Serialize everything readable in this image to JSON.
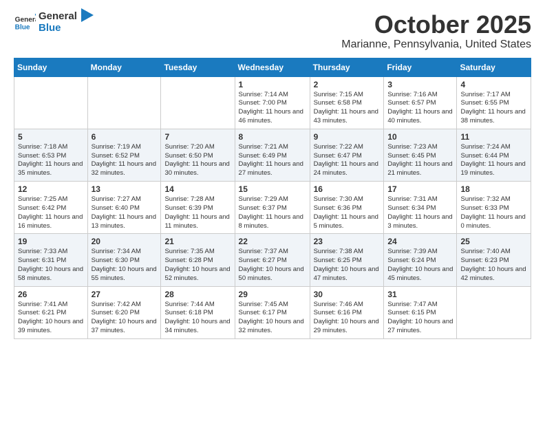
{
  "logo": {
    "line1": "General",
    "line2": "Blue"
  },
  "title": "October 2025",
  "subtitle": "Marianne, Pennsylvania, United States",
  "days_of_week": [
    "Sunday",
    "Monday",
    "Tuesday",
    "Wednesday",
    "Thursday",
    "Friday",
    "Saturday"
  ],
  "weeks": [
    [
      {
        "day": "",
        "info": ""
      },
      {
        "day": "",
        "info": ""
      },
      {
        "day": "",
        "info": ""
      },
      {
        "day": "1",
        "info": "Sunrise: 7:14 AM\nSunset: 7:00 PM\nDaylight: 11 hours and 46 minutes."
      },
      {
        "day": "2",
        "info": "Sunrise: 7:15 AM\nSunset: 6:58 PM\nDaylight: 11 hours and 43 minutes."
      },
      {
        "day": "3",
        "info": "Sunrise: 7:16 AM\nSunset: 6:57 PM\nDaylight: 11 hours and 40 minutes."
      },
      {
        "day": "4",
        "info": "Sunrise: 7:17 AM\nSunset: 6:55 PM\nDaylight: 11 hours and 38 minutes."
      }
    ],
    [
      {
        "day": "5",
        "info": "Sunrise: 7:18 AM\nSunset: 6:53 PM\nDaylight: 11 hours and 35 minutes."
      },
      {
        "day": "6",
        "info": "Sunrise: 7:19 AM\nSunset: 6:52 PM\nDaylight: 11 hours and 32 minutes."
      },
      {
        "day": "7",
        "info": "Sunrise: 7:20 AM\nSunset: 6:50 PM\nDaylight: 11 hours and 30 minutes."
      },
      {
        "day": "8",
        "info": "Sunrise: 7:21 AM\nSunset: 6:49 PM\nDaylight: 11 hours and 27 minutes."
      },
      {
        "day": "9",
        "info": "Sunrise: 7:22 AM\nSunset: 6:47 PM\nDaylight: 11 hours and 24 minutes."
      },
      {
        "day": "10",
        "info": "Sunrise: 7:23 AM\nSunset: 6:45 PM\nDaylight: 11 hours and 21 minutes."
      },
      {
        "day": "11",
        "info": "Sunrise: 7:24 AM\nSunset: 6:44 PM\nDaylight: 11 hours and 19 minutes."
      }
    ],
    [
      {
        "day": "12",
        "info": "Sunrise: 7:25 AM\nSunset: 6:42 PM\nDaylight: 11 hours and 16 minutes."
      },
      {
        "day": "13",
        "info": "Sunrise: 7:27 AM\nSunset: 6:40 PM\nDaylight: 11 hours and 13 minutes."
      },
      {
        "day": "14",
        "info": "Sunrise: 7:28 AM\nSunset: 6:39 PM\nDaylight: 11 hours and 11 minutes."
      },
      {
        "day": "15",
        "info": "Sunrise: 7:29 AM\nSunset: 6:37 PM\nDaylight: 11 hours and 8 minutes."
      },
      {
        "day": "16",
        "info": "Sunrise: 7:30 AM\nSunset: 6:36 PM\nDaylight: 11 hours and 5 minutes."
      },
      {
        "day": "17",
        "info": "Sunrise: 7:31 AM\nSunset: 6:34 PM\nDaylight: 11 hours and 3 minutes."
      },
      {
        "day": "18",
        "info": "Sunrise: 7:32 AM\nSunset: 6:33 PM\nDaylight: 11 hours and 0 minutes."
      }
    ],
    [
      {
        "day": "19",
        "info": "Sunrise: 7:33 AM\nSunset: 6:31 PM\nDaylight: 10 hours and 58 minutes."
      },
      {
        "day": "20",
        "info": "Sunrise: 7:34 AM\nSunset: 6:30 PM\nDaylight: 10 hours and 55 minutes."
      },
      {
        "day": "21",
        "info": "Sunrise: 7:35 AM\nSunset: 6:28 PM\nDaylight: 10 hours and 52 minutes."
      },
      {
        "day": "22",
        "info": "Sunrise: 7:37 AM\nSunset: 6:27 PM\nDaylight: 10 hours and 50 minutes."
      },
      {
        "day": "23",
        "info": "Sunrise: 7:38 AM\nSunset: 6:25 PM\nDaylight: 10 hours and 47 minutes."
      },
      {
        "day": "24",
        "info": "Sunrise: 7:39 AM\nSunset: 6:24 PM\nDaylight: 10 hours and 45 minutes."
      },
      {
        "day": "25",
        "info": "Sunrise: 7:40 AM\nSunset: 6:23 PM\nDaylight: 10 hours and 42 minutes."
      }
    ],
    [
      {
        "day": "26",
        "info": "Sunrise: 7:41 AM\nSunset: 6:21 PM\nDaylight: 10 hours and 39 minutes."
      },
      {
        "day": "27",
        "info": "Sunrise: 7:42 AM\nSunset: 6:20 PM\nDaylight: 10 hours and 37 minutes."
      },
      {
        "day": "28",
        "info": "Sunrise: 7:44 AM\nSunset: 6:18 PM\nDaylight: 10 hours and 34 minutes."
      },
      {
        "day": "29",
        "info": "Sunrise: 7:45 AM\nSunset: 6:17 PM\nDaylight: 10 hours and 32 minutes."
      },
      {
        "day": "30",
        "info": "Sunrise: 7:46 AM\nSunset: 6:16 PM\nDaylight: 10 hours and 29 minutes."
      },
      {
        "day": "31",
        "info": "Sunrise: 7:47 AM\nSunset: 6:15 PM\nDaylight: 10 hours and 27 minutes."
      },
      {
        "day": "",
        "info": ""
      }
    ]
  ],
  "colors": {
    "header_bg": "#1a7abf",
    "row_even": "#f0f4f8",
    "row_odd": "#ffffff"
  }
}
